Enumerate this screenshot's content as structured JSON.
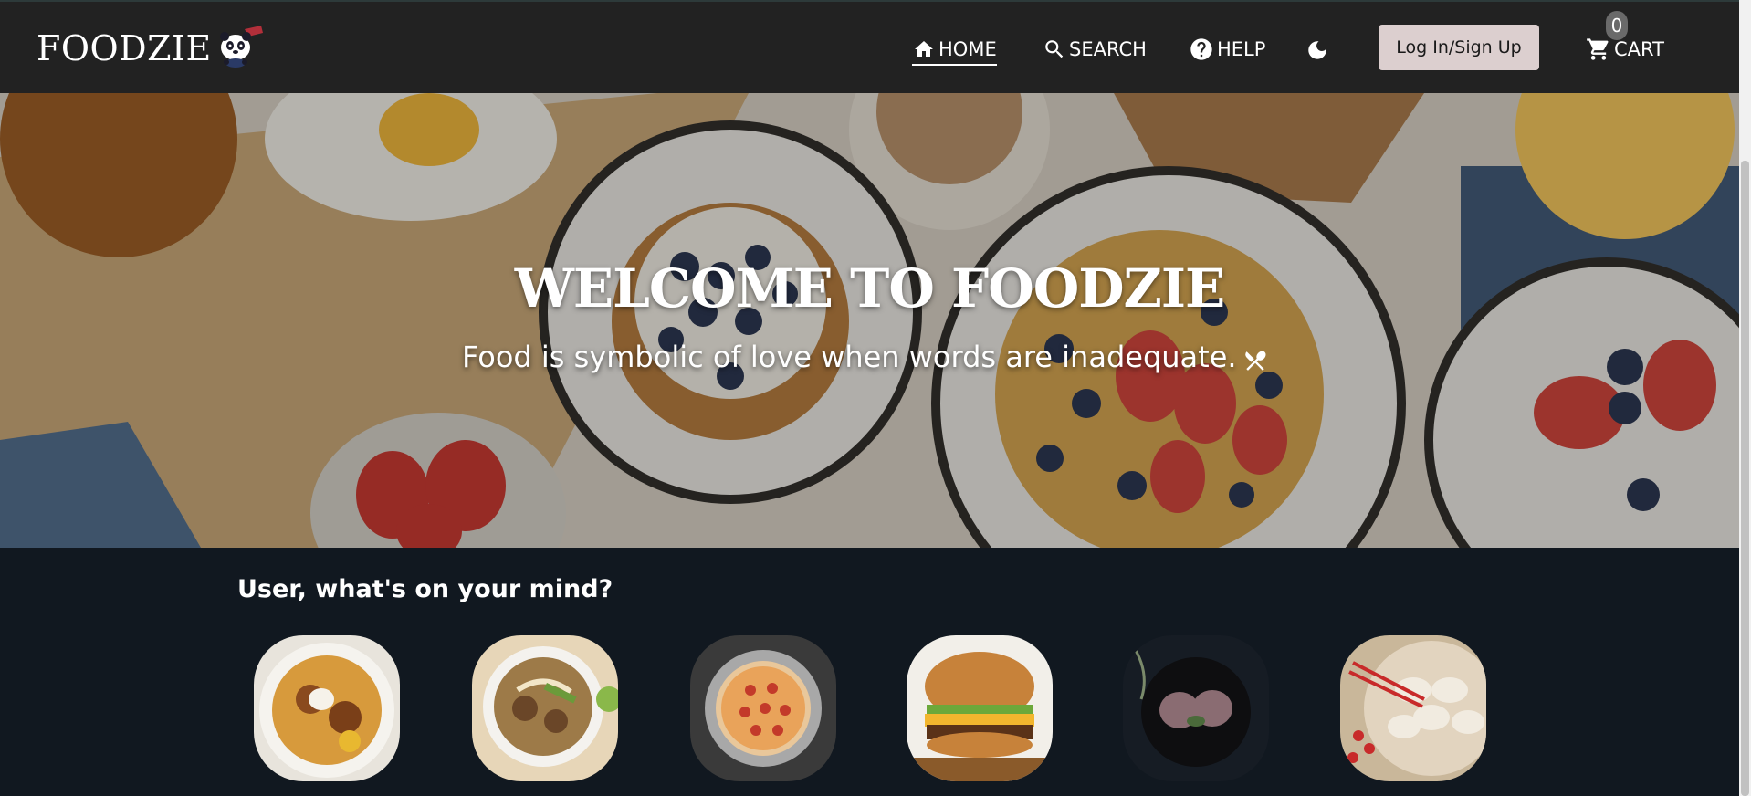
{
  "nav": {
    "brand": "FOODZIE",
    "home": "HOME",
    "search": "SEARCH",
    "help": "HELP",
    "login": "Log In/Sign Up",
    "cart": "CART",
    "cart_count": "0",
    "icons": [
      "panda-logo",
      "home-icon",
      "search-icon",
      "help-icon",
      "moon-icon",
      "cart-icon"
    ]
  },
  "hero": {
    "title": "WELCOME TO FOODZIE",
    "subtitle": "Food is symbolic of love when words are inadequate."
  },
  "mind": {
    "heading": "User, what's on your mind?",
    "items": [
      "biryani",
      "noodle-soup",
      "pizza",
      "burger",
      "dessert",
      "dumplings"
    ]
  },
  "colors": {
    "navbar": "#222222",
    "section_bg": "#111820",
    "login_button": "#dccfcf"
  }
}
